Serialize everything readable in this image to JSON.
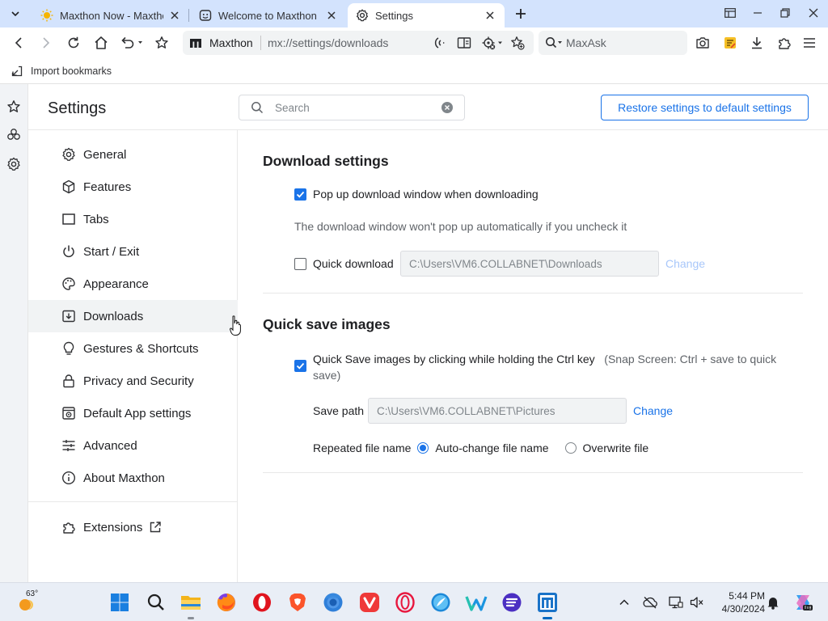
{
  "browser": {
    "tabs": [
      {
        "title": "Maxthon Now - Maxtho",
        "icon": "sun-icon"
      },
      {
        "title": "Welcome to Maxthon Br",
        "icon": "maxthon-face-icon"
      },
      {
        "title": "Settings",
        "icon": "gear-icon"
      }
    ],
    "active_tab": 2,
    "address": {
      "brand": "Maxthon",
      "url": "mx://settings/downloads"
    },
    "search": {
      "placeholder": "MaxAsk"
    },
    "bookmarks_bar": {
      "import_label": "Import bookmarks"
    }
  },
  "settings": {
    "title": "Settings",
    "search_placeholder": "Search",
    "restore_label": "Restore settings to default settings",
    "nav": [
      {
        "label": "General",
        "icon": "gear-icon"
      },
      {
        "label": "Features",
        "icon": "cube-icon"
      },
      {
        "label": "Tabs",
        "icon": "tab-icon"
      },
      {
        "label": "Start / Exit",
        "icon": "power-icon"
      },
      {
        "label": "Appearance",
        "icon": "palette-icon"
      },
      {
        "label": "Downloads",
        "icon": "download-icon"
      },
      {
        "label": "Gestures & Shortcuts",
        "icon": "bulb-icon"
      },
      {
        "label": "Privacy and Security",
        "icon": "lock-icon"
      },
      {
        "label": "Default App settings",
        "icon": "browser-icon"
      },
      {
        "label": "Advanced",
        "icon": "sliders-icon"
      },
      {
        "label": "About Maxthon",
        "icon": "info-icon"
      }
    ],
    "selected_nav": "Downloads",
    "extensions_label": "Extensions",
    "download": {
      "title": "Download settings",
      "popup_label": "Pop up download window when downloading",
      "popup_checked": true,
      "popup_hint": "The download window won't pop up automatically if you uncheck it",
      "quick_label": "Quick download",
      "quick_checked": false,
      "quick_path": "C:\\Users\\VM6.COLLABNET\\Downloads",
      "change_label": "Change"
    },
    "quick_save": {
      "title": "Quick save images",
      "label": "Quick Save images by clicking while holding the Ctrl key",
      "note": "(Snap Screen: Ctrl + save to quick save)",
      "checked": true,
      "save_path_label": "Save path",
      "save_path": "C:\\Users\\VM6.COLLABNET\\Pictures",
      "change_label": "Change",
      "repeated_label": "Repeated file name",
      "option_auto": "Auto-change file name",
      "option_overwrite": "Overwrite file",
      "selected_option": "Auto-change file name"
    }
  },
  "taskbar": {
    "weather_temp": "63°",
    "time": "5:44 PM",
    "date": "4/30/2024",
    "accent": "#0067c0",
    "apps": [
      "windows-start-icon",
      "search-icon",
      "file-explorer-icon",
      "firefox-icon",
      "opera-icon",
      "brave-icon",
      "chrome-icon",
      "vivaldi-icon",
      "opera-gx-icon",
      "falkon-icon",
      "waterfox-icon",
      "floorp-icon",
      "maxthon-icon"
    ]
  },
  "colors": {
    "accent": "#1a73e8",
    "tabstrip": "#d3e3fd"
  }
}
